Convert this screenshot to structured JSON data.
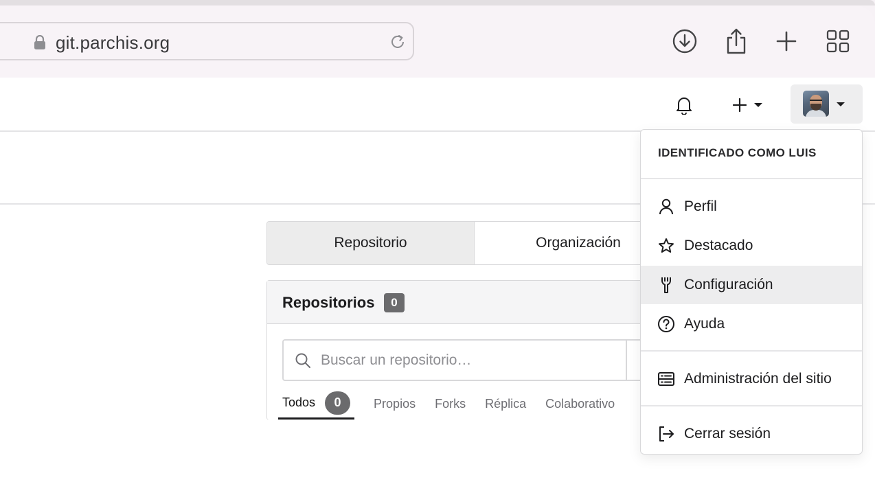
{
  "browser": {
    "url": "git.parchis.org",
    "toolbar_icons": [
      "lock-icon",
      "reload-icon",
      "download-icon",
      "share-icon",
      "new-tab-icon",
      "tab-overview-icon"
    ]
  },
  "header": {
    "icons": [
      "bell-icon",
      "plus-icon",
      "chevron-down-icon"
    ]
  },
  "tabs": [
    {
      "label": "Repositorio",
      "active": true
    },
    {
      "label": "Organización",
      "active": false
    }
  ],
  "repos": {
    "title": "Repositorios",
    "count": "0",
    "search_placeholder": "Buscar un repositorio…",
    "filters": [
      {
        "label": "Todos",
        "count": "0",
        "active": true
      },
      {
        "label": "Propios"
      },
      {
        "label": "Forks"
      },
      {
        "label": "Réplica"
      },
      {
        "label": "Colaborativo"
      }
    ]
  },
  "user_menu": {
    "header": "IDENTIFICADO COMO LUIS",
    "items": [
      {
        "label": "Perfil",
        "icon": "person-icon"
      },
      {
        "label": "Destacado",
        "icon": "star-icon"
      },
      {
        "label": "Configuración",
        "icon": "wrench-icon",
        "hovered": true
      },
      {
        "label": "Ayuda",
        "icon": "help-icon"
      },
      {
        "label": "Administración del sitio",
        "icon": "server-icon"
      },
      {
        "label": "Cerrar sesión",
        "icon": "sign-out-icon"
      }
    ]
  },
  "colors": {
    "browser_bg": "#f8f3f7",
    "badge": "#6b6b6d",
    "hover": "#ededee"
  }
}
